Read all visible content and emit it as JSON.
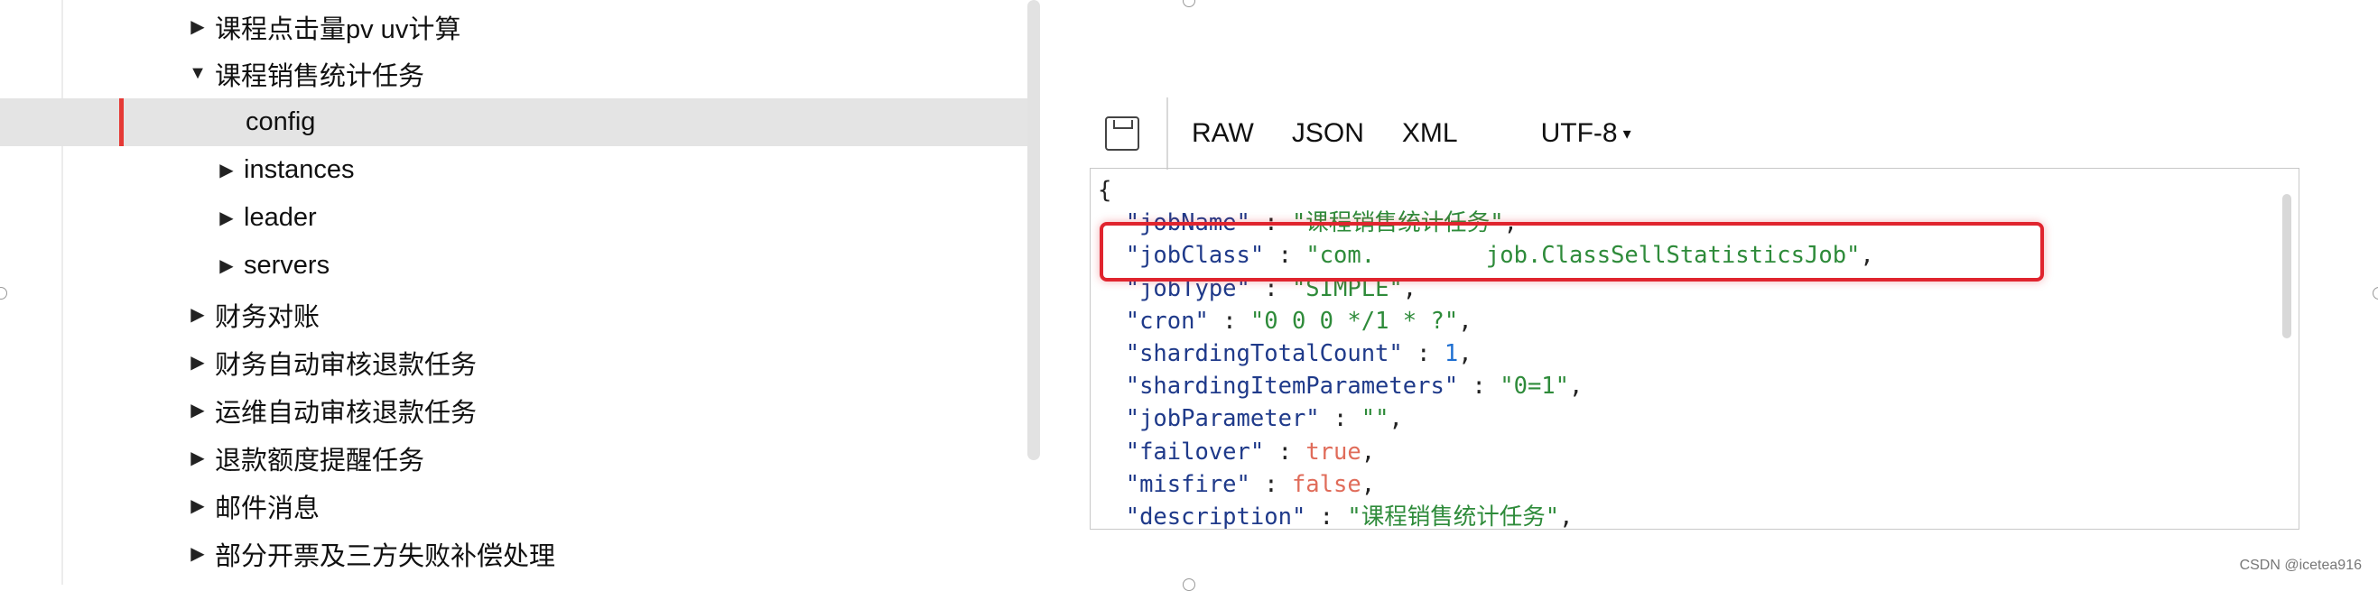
{
  "tree": {
    "items": [
      {
        "label": "课程点击量pv uv计算",
        "arrow": "▶",
        "indent": 0,
        "selected": false
      },
      {
        "label": "课程销售统计任务",
        "arrow": "▼",
        "indent": 0,
        "selected": false
      },
      {
        "label": "config",
        "arrow": "",
        "indent": 2,
        "selected": true
      },
      {
        "label": "instances",
        "arrow": "▶",
        "indent": 1,
        "selected": false
      },
      {
        "label": "leader",
        "arrow": "▶",
        "indent": 1,
        "selected": false
      },
      {
        "label": "servers",
        "arrow": "▶",
        "indent": 1,
        "selected": false
      },
      {
        "label": "财务对账",
        "arrow": "▶",
        "indent": 0,
        "selected": false
      },
      {
        "label": "财务自动审核退款任务",
        "arrow": "▶",
        "indent": 0,
        "selected": false
      },
      {
        "label": "运维自动审核退款任务",
        "arrow": "▶",
        "indent": 0,
        "selected": false
      },
      {
        "label": "退款额度提醒任务",
        "arrow": "▶",
        "indent": 0,
        "selected": false
      },
      {
        "label": "邮件消息",
        "arrow": "▶",
        "indent": 0,
        "selected": false
      },
      {
        "label": "部分开票及三方失败补偿处理",
        "arrow": "▶",
        "indent": 0,
        "selected": false
      }
    ]
  },
  "toolbar": {
    "save_icon": "floppy-disk-icon",
    "raw": "RAW",
    "json": "JSON",
    "xml": "XML",
    "encoding": "UTF-8",
    "caret": "▾"
  },
  "json": {
    "open_brace": "{",
    "lines": [
      {
        "key": "\"jobName\"",
        "value": "\"课程销售统计任务\"",
        "type": "string",
        "tail": ","
      },
      {
        "key": "\"jobClass\"",
        "value": "\"com.        job.ClassSellStatisticsJob\"",
        "type": "string",
        "tail": ","
      },
      {
        "key": "\"jobType\"",
        "value": "\"SIMPLE\"",
        "type": "string",
        "tail": ","
      },
      {
        "key": "\"cron\"",
        "value": "\"0 0 0 */1 * ?\"",
        "type": "string",
        "tail": ","
      },
      {
        "key": "\"shardingTotalCount\"",
        "value": "1",
        "type": "number",
        "tail": ","
      },
      {
        "key": "\"shardingItemParameters\"",
        "value": "\"0=1\"",
        "type": "string",
        "tail": ","
      },
      {
        "key": "\"jobParameter\"",
        "value": "\"\"",
        "type": "string",
        "tail": ","
      },
      {
        "key": "\"failover\"",
        "value": "true",
        "type": "bool",
        "tail": ","
      },
      {
        "key": "\"misfire\"",
        "value": "false",
        "type": "bool",
        "tail": ","
      },
      {
        "key": "\"description\"",
        "value": "\"课程销售统计任务\"",
        "type": "string",
        "tail": ","
      }
    ]
  },
  "colors": {
    "selection_bar": "#e53935",
    "highlight_box": "#e0242e",
    "json_key": "#1f3a8a",
    "json_string": "#2e8b3a",
    "json_number": "#1f6fd1",
    "json_bool": "#e06c5a"
  },
  "watermark": "CSDN @icetea916"
}
